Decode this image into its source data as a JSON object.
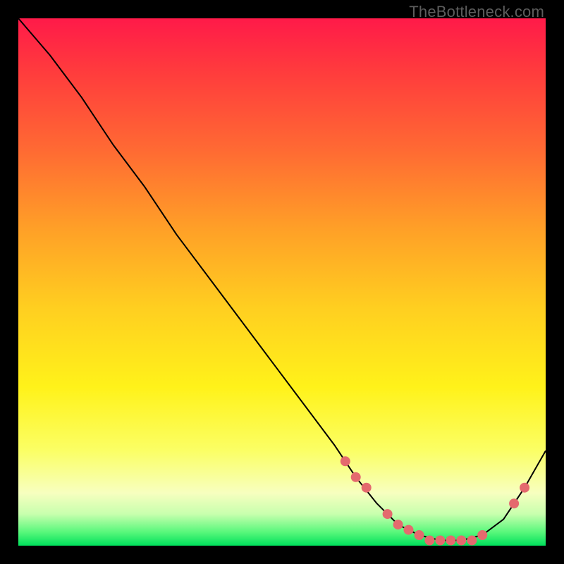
{
  "watermark": "TheBottleneck.com",
  "colors": {
    "dot": "#e46a6e",
    "line": "#000000",
    "frame": "#000000"
  },
  "chart_data": {
    "type": "line",
    "title": "",
    "xlabel": "",
    "ylabel": "",
    "xlim": [
      0,
      100
    ],
    "ylim": [
      0,
      100
    ],
    "grid": false,
    "legend": false,
    "series": [
      {
        "name": "bottleneck-curve",
        "x": [
          0,
          6,
          12,
          18,
          24,
          30,
          36,
          42,
          48,
          54,
          60,
          64,
          68,
          72,
          76,
          80,
          84,
          88,
          92,
          96,
          100
        ],
        "y": [
          100,
          93,
          85,
          76,
          68,
          59,
          51,
          43,
          35,
          27,
          19,
          13,
          8,
          4,
          2,
          1,
          1,
          2,
          5,
          11,
          18
        ]
      }
    ],
    "highlight_points": {
      "series": "bottleneck-curve",
      "x": [
        62,
        64,
        66,
        70,
        72,
        74,
        76,
        78,
        80,
        82,
        84,
        86,
        88,
        94,
        96
      ],
      "y": [
        16,
        13,
        11,
        6,
        4,
        3,
        2,
        1,
        1,
        1,
        1,
        1,
        2,
        8,
        11
      ]
    }
  }
}
